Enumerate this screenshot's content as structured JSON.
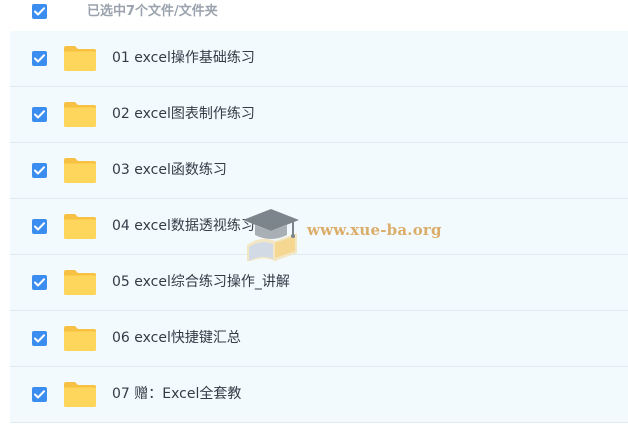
{
  "header": {
    "selection_text": "已选中7个文件/文件夹"
  },
  "files": [
    {
      "name": "01 excel操作基础练习",
      "checked": true,
      "icon": "folder-icon"
    },
    {
      "name": "02 excel图表制作练习",
      "checked": true,
      "icon": "folder-icon"
    },
    {
      "name": "03 excel函数练习",
      "checked": true,
      "icon": "folder-icon"
    },
    {
      "name": "04 excel数据透视练习",
      "checked": true,
      "icon": "folder-icon"
    },
    {
      "name": "05 excel综合练习操作_讲解",
      "checked": true,
      "icon": "folder-icon"
    },
    {
      "name": "06 excel快捷键汇总",
      "checked": true,
      "icon": "folder-icon"
    },
    {
      "name": "07 赠：Excel全套教",
      "checked": true,
      "icon": "folder-icon"
    }
  ],
  "watermark": {
    "text": "www.xue-ba.org",
    "icon": "graduation-cap-icon"
  },
  "colors": {
    "checkbox": "#3b8ef0",
    "row_background": "#f3fafd",
    "folder": "#ffd25a",
    "watermark_text": "#d9a55b"
  }
}
